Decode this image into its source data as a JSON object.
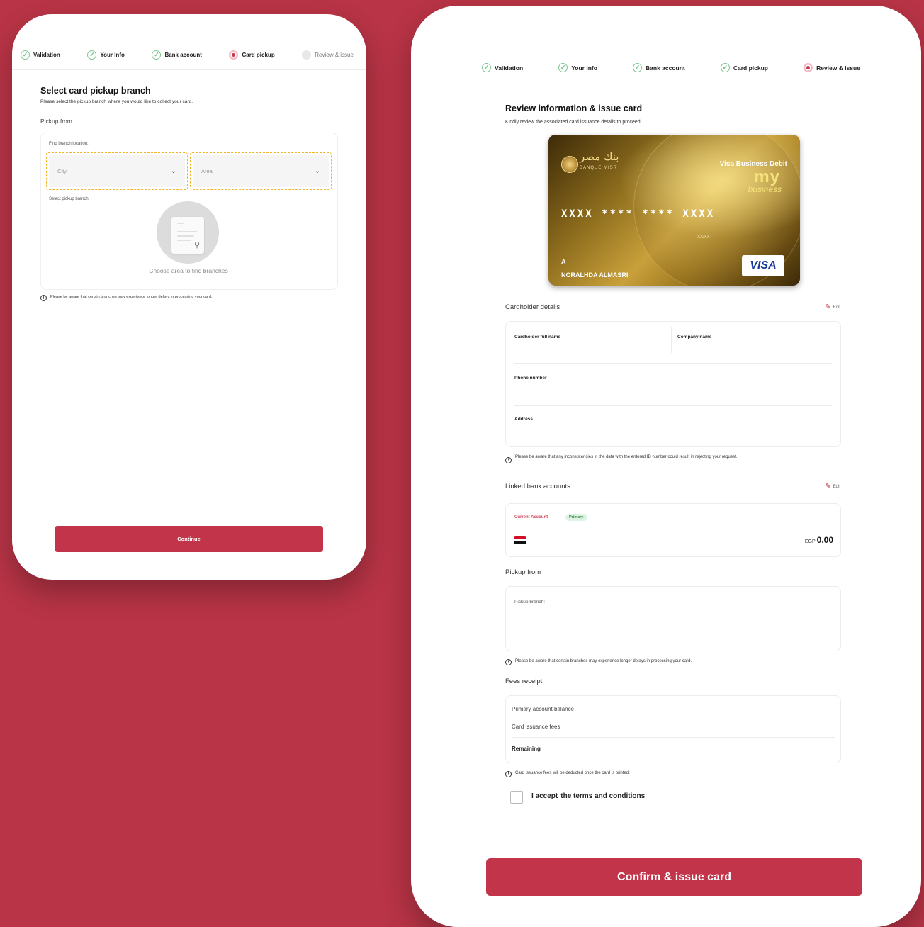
{
  "steps": {
    "validation": "Validation",
    "your_info": "Your Info",
    "bank_account": "Bank account",
    "card_pickup": "Card pickup",
    "review_issue": "Review & issue"
  },
  "left_screen": {
    "title": "Select card pickup branch",
    "subtitle": "Please select the pickup branch where you would like to collect your card.",
    "pickup_label": "Pickup from",
    "find_label": "Find branch location:",
    "city_placeholder": "City",
    "area_placeholder": "Area",
    "select_branch_label": "Select pickup branch:",
    "empty_text": "Choose area to find branches",
    "note": "Please be aware that certain branches may experience longer delays in processing your card.",
    "continue_label": "Continue",
    "current_step": "Card pickup"
  },
  "right_screen": {
    "title": "Review information & issue card",
    "subtitle": "Kindly review the associated card issuance details to proceed.",
    "current_step": "Review & issue",
    "card": {
      "bank_name_arabic": "بنك مصر",
      "bank_name_latin": "BANQUE MISR",
      "product": "Visa Business Debit",
      "product_my": "my",
      "product_business": "business",
      "number": "XXXX **** **** XXXX",
      "expiry": "XX/XX",
      "initial": "A",
      "holder": "NORALHDA ALMASRI",
      "network": "VISA"
    },
    "cardholder_label": "Cardholder details",
    "edit_label": "Edit",
    "fields": {
      "full_name": "Cardholder full name",
      "company": "Company name",
      "phone": "Phone number",
      "address": "Address"
    },
    "id_note": "Please be aware that any inconsistencies in the data with the entered ID number could result in rejecting your request.",
    "linked_accounts_label": "Linked bank accounts",
    "account": {
      "type": "Current Account",
      "badge": "Primary",
      "currency": "EGP",
      "balance": "0.00"
    },
    "pickup_label": "Pickup from",
    "pickup_branch_label": "Pickup branch:",
    "branch_note": "Please be aware that certain branches may experience longer delays in processing your card.",
    "fees_label": "Fees receipt",
    "fees": {
      "balance": "Primary account balance",
      "issuance": "Card issuance fees",
      "remaining": "Remaining"
    },
    "fees_note": "Card issuance fees will be deducted once the card is printed.",
    "accept_text": "I accept",
    "terms_link": "the terms and conditions",
    "confirm_label": "Confirm & issue card"
  },
  "colors": {
    "background": "#b83446",
    "primary": "#c23449",
    "success": "#7ec48f",
    "selection_outline": "#f0b429"
  },
  "icons": {
    "completed_step": "check-circle-icon",
    "current_step": "radio-dot-icon",
    "info": "info-icon",
    "edit": "pencil-icon",
    "dropdown": "chevron-down-icon"
  }
}
